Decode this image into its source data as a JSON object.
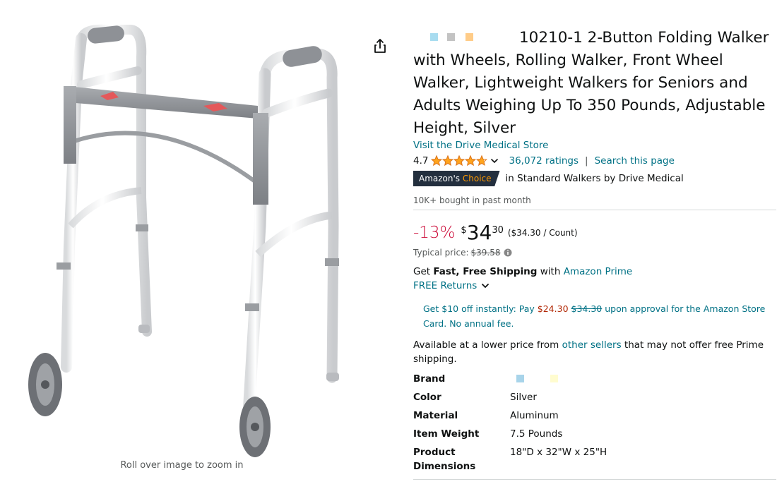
{
  "image": {
    "zoom_hint": "Roll over image to zoom in",
    "share_icon": "share-icon"
  },
  "product": {
    "title": "10210-1 2-Button Folding Walker with Wheels, Rolling Walker, Front Wheel Walker, Lightweight Walkers for Seniors and Adults Weighing Up To 350 Pounds, Adjustable Height, Silver",
    "store_link": "Visit the Drive Medical Store",
    "rating": "4.7",
    "stars": 4.7,
    "ratings_count": "36,072 ratings",
    "separator": "|",
    "search_page": "Search this page",
    "choice_badge_prefix": "Amazon's",
    "choice_badge_accent": "Choice",
    "choice_category": "in Standard Walkers by Drive Medical",
    "bought": "10K+ bought in past month"
  },
  "price": {
    "discount": "-13%",
    "symbol": "$",
    "whole": "34",
    "fraction": "30",
    "unit": "($34.30 / Count)",
    "typical_label": "Typical price:",
    "typical_value": "$39.58"
  },
  "shipping": {
    "get": "Get",
    "fast_free": "Fast, Free Shipping",
    "with": "with",
    "prime": "Amazon Prime",
    "returns": "FREE Returns"
  },
  "promo": {
    "part1": "Get $10 off instantly: Pay",
    "pay_price": "$24.30",
    "old_price": "$34.30",
    "part2": "upon approval for the Amazon Store Card. No annual fee."
  },
  "lower_price": {
    "part1": "Available at a lower price from",
    "link": "other sellers",
    "part2": "that may not offer free Prime shipping."
  },
  "specs": [
    {
      "label": "Brand",
      "value": ""
    },
    {
      "label": "Color",
      "value": "Silver"
    },
    {
      "label": "Material",
      "value": "Aluminum"
    },
    {
      "label": "Item Weight",
      "value": "7.5 Pounds"
    },
    {
      "label": "Product Dimensions",
      "value": "18\"D x 32\"W x 25\"H"
    }
  ],
  "colors": {
    "link": "#007185",
    "star": "#ffa41c",
    "discount": "#cc0c39",
    "badge": "#232f3e",
    "badge_accent": "#ff9900"
  }
}
